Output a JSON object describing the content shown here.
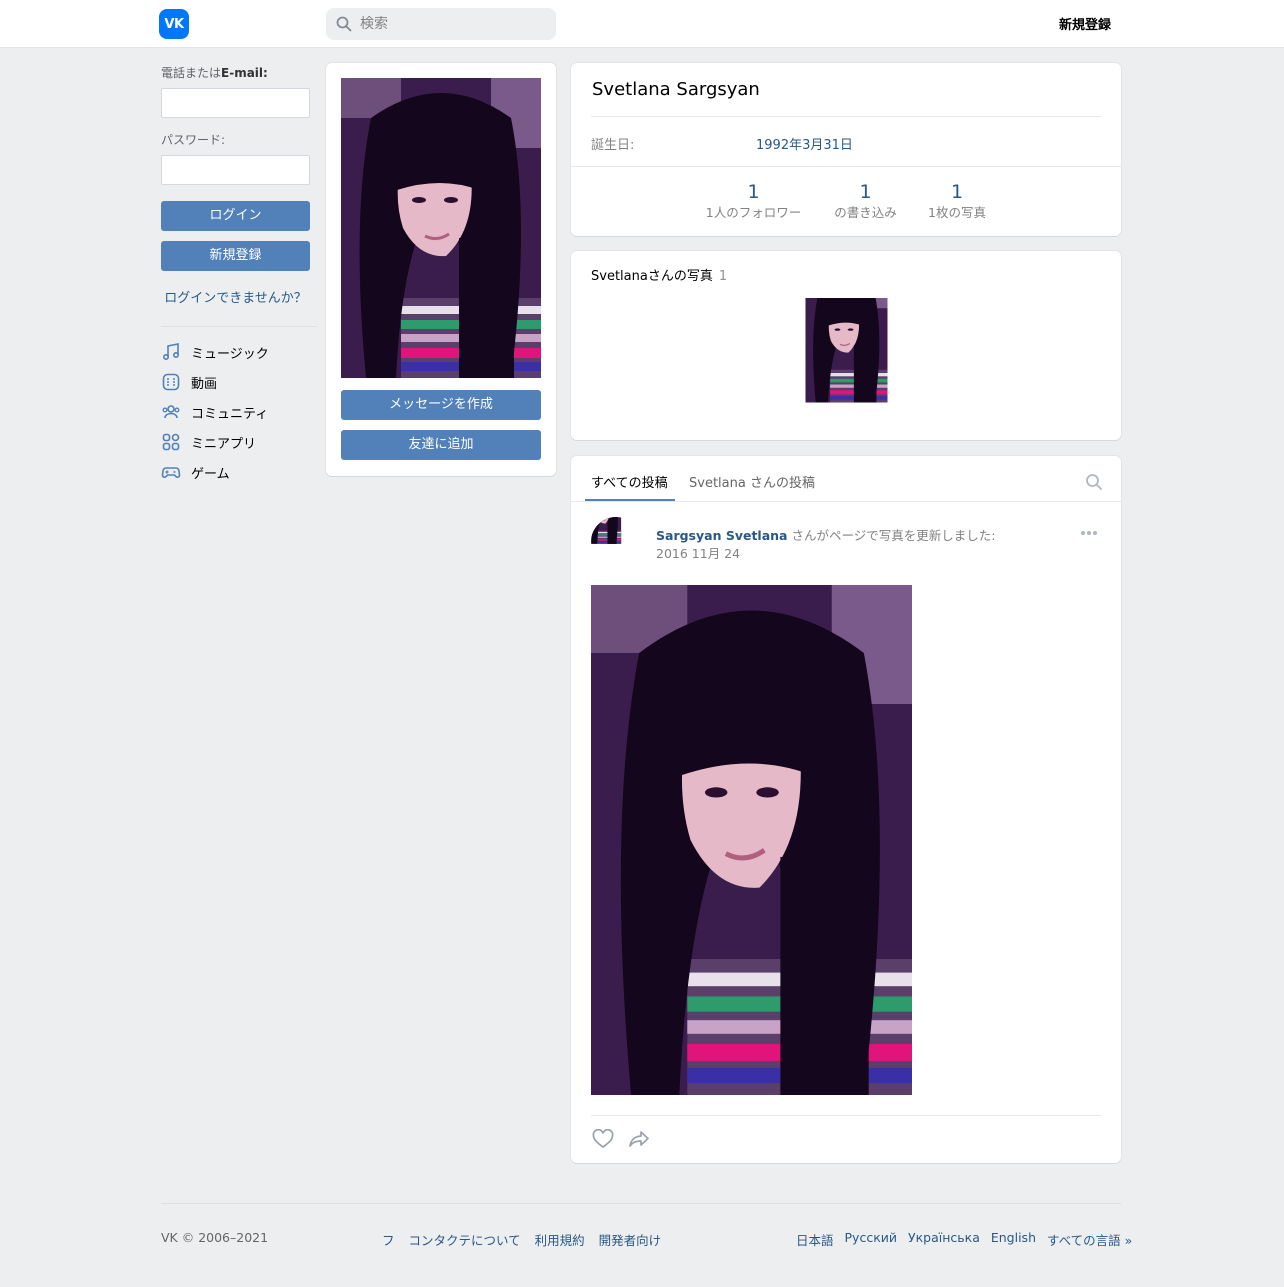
{
  "header": {
    "logo_text": "VK",
    "search_placeholder": "検索",
    "register": "新規登録"
  },
  "login": {
    "phone_label_prefix": "電話または",
    "phone_label_bold": "E-mail:",
    "password_label": "パスワード:",
    "login_button": "ログイン",
    "register_button": "新規登録",
    "forgot": "ログインできませんか？"
  },
  "menu": [
    {
      "label": "ミュージック",
      "icon": "music-icon"
    },
    {
      "label": "動画",
      "icon": "video-icon"
    },
    {
      "label": "コミュニティ",
      "icon": "community-icon"
    },
    {
      "label": "ミニアプリ",
      "icon": "mini-apps-icon"
    },
    {
      "label": "ゲーム",
      "icon": "gamepad-icon"
    }
  ],
  "profile_actions": {
    "message": "メッセージを作成",
    "add_friend": "友達に追加"
  },
  "profile": {
    "name": "Svetlana Sargsyan",
    "birthday_label": "誕生日:",
    "birthday_value": "1992年3月31日",
    "counters": [
      {
        "num": "1",
        "label": "1人のフォロワー"
      },
      {
        "num": "1",
        "label": "の書き込み"
      },
      {
        "num": "1",
        "label": "1枚の写真"
      }
    ]
  },
  "photos": {
    "title": "Svetlanaさんの写真",
    "count": "1"
  },
  "wall": {
    "tab_all": "すべての投稿",
    "tab_own": "Svetlana さんの投稿",
    "post": {
      "author": "Sargsyan Svetlana",
      "action": " さんがページで写真を更新しました:",
      "date": "2016 11月 24"
    }
  },
  "footer": {
    "copyright": "VK © 2006–2021",
    "links": [
      "フ",
      "コンタクテについて",
      "利用規約",
      "開発者向け"
    ],
    "languages": [
      "日本語",
      "Русский",
      "Українська",
      "English",
      "すべての言語 »"
    ]
  },
  "colors": {
    "accent": "#5181b8",
    "link": "#2a5885",
    "background": "#edeef0",
    "brand": "#0077ff"
  }
}
